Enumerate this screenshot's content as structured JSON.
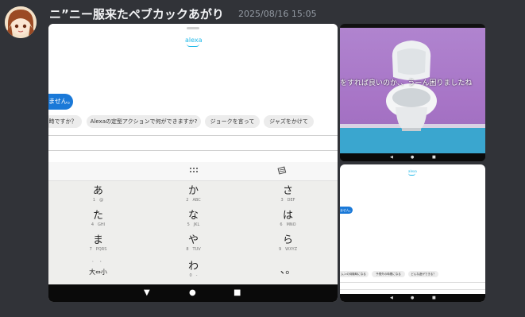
{
  "message": {
    "username": "ニ”ニー服来たペブカックあがり",
    "timestamp": "2025/08/16 15:05"
  },
  "main_screenshot": {
    "alexa_logo": "alexa",
    "bubble_text": "ません。",
    "chips": [
      "時ですか？",
      "Alexaの定型アクションで何ができますか?",
      "ジョークを言って",
      "ジャズをかけて"
    ],
    "keyboard_keys": [
      {
        "main": "あ",
        "sub": "1　@"
      },
      {
        "main": "か",
        "sub": "2　ABC"
      },
      {
        "main": "さ",
        "sub": "3　DEF"
      },
      {
        "main": "た",
        "sub": "4　GHI"
      },
      {
        "main": "な",
        "sub": "5　JKL"
      },
      {
        "main": "は",
        "sub": "6　MNO"
      },
      {
        "main": "ま",
        "sub": "7　PQRS"
      },
      {
        "main": "や",
        "sub": "8　TUV"
      },
      {
        "main": "ら",
        "sub": "9　WXYZ"
      },
      {
        "main": "大⇔小",
        "sub": "゛　゜"
      },
      {
        "main": "わ",
        "sub": "0　-"
      },
      {
        "main": "、。",
        "sub": ""
      }
    ],
    "nav": {
      "back": "▼",
      "home": "●",
      "recents": "■"
    }
  },
  "photo_screenshot": {
    "overlay_text": "をすれば良いのか、、うーん困りましたね",
    "nav": {
      "back": "◀",
      "home": "●",
      "recents": "■"
    }
  },
  "small_screenshot": {
    "alexa_logo": "alexa",
    "bubble_text": "ません。",
    "chips": [
      "ムンの待機時になる",
      "予想外の時間になる",
      "どんな遊ができる？"
    ],
    "nav": {
      "back": "◀",
      "home": "●",
      "recents": "■"
    }
  }
}
